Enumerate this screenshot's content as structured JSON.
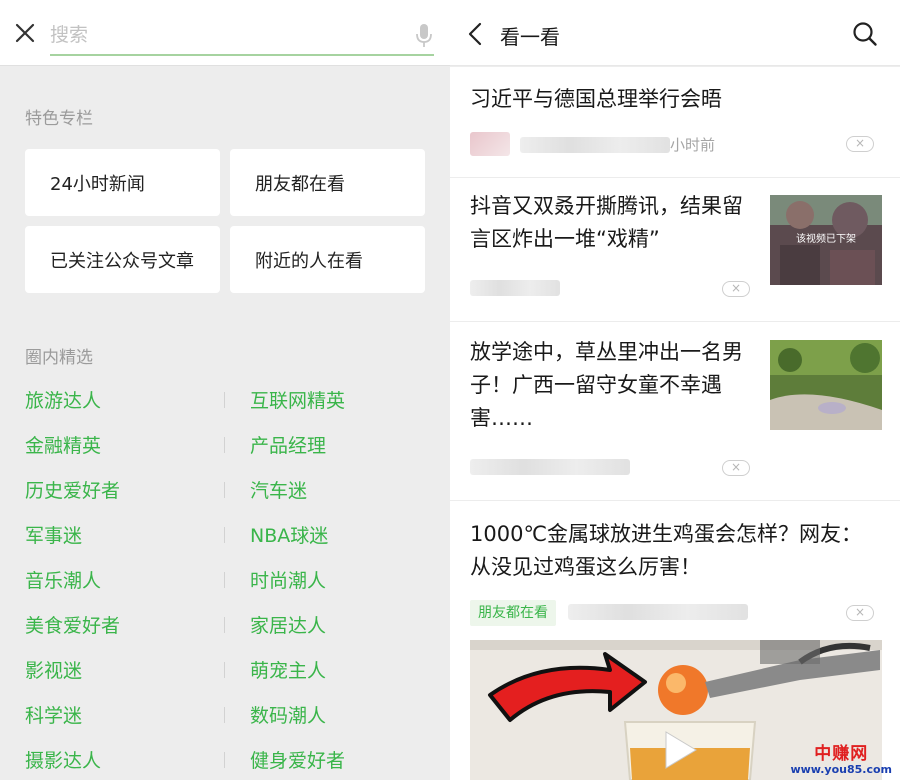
{
  "search": {
    "placeholder": "搜索"
  },
  "featured": {
    "title": "特色专栏",
    "cards": [
      {
        "label": "24小时新闻"
      },
      {
        "label": "朋友都在看"
      },
      {
        "label": "已关注公众号文章"
      },
      {
        "label": "附近的人在看"
      }
    ]
  },
  "circle": {
    "title": "圈内精选",
    "left_items": [
      "旅游达人",
      "金融精英",
      "历史爱好者",
      "军事迷",
      "音乐潮人",
      "美食爱好者",
      "影视迷",
      "科学迷",
      "摄影达人"
    ],
    "right_items": [
      "互联网精英",
      "产品经理",
      "汽车迷",
      "NBA球迷",
      "时尚潮人",
      "家居达人",
      "萌宠主人",
      "数码潮人",
      "健身爱好者"
    ]
  },
  "header": {
    "title": "看一看"
  },
  "articles": [
    {
      "title": "习近平与德国总理举行会晤",
      "time_suffix": "小时前"
    },
    {
      "title_lines": [
        "抖音又双叒开撕腾讯，结果留",
        "言区炸出一堆“戏精”"
      ],
      "thumb_caption": "该视频已下架"
    },
    {
      "title_lines": [
        "放学途中，草丛里冲出一名男",
        "子！广西一留守女童不幸遇",
        "害……"
      ]
    },
    {
      "title_lines": [
        "1000℃金属球放进生鸡蛋会怎样？网友：",
        "从没见过鸡蛋这么厉害！"
      ],
      "badge": "朋友都在看"
    }
  ],
  "dismiss_symbol": "×",
  "watermark": {
    "logo": "中赚网",
    "url": "www.you85.com"
  },
  "colors": {
    "accent_green": "#3ab54a",
    "background": "#ededed",
    "watermark_red": "#e02020",
    "watermark_blue": "#1a3fb0"
  }
}
